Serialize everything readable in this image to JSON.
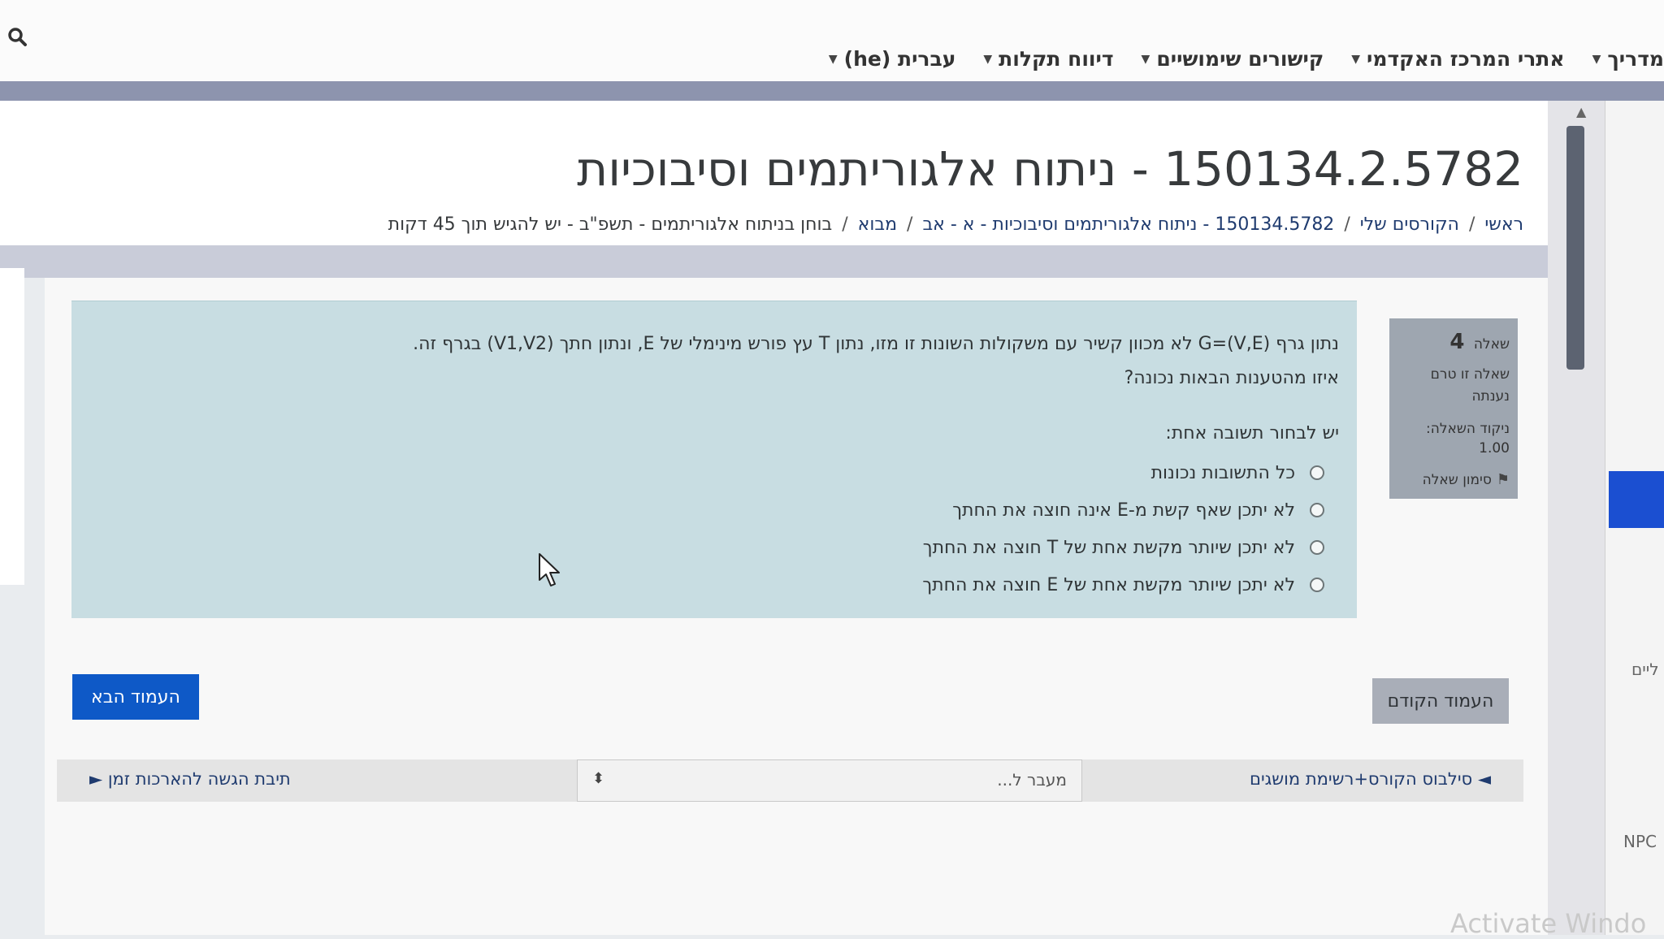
{
  "navbar": {
    "menu": [
      {
        "label": "מדריך"
      },
      {
        "label": "אתרי המרכז האקדמי"
      },
      {
        "label": "קישורים שימושיים"
      },
      {
        "label": "דיווח תקלות"
      },
      {
        "label": "עברית (he)"
      }
    ]
  },
  "header": {
    "title": "150134.2.5782 - ניתוח אלגוריתמים וסיבוכיות",
    "breadcrumb": [
      "ראשי",
      "הקורסים שלי",
      "150134.5782 - ניתוח אלגוריתמים וסיבוכיות - א - אב",
      "מבוא",
      "בוחן בניתוח אלגוריתמים - תשפ\"ב - יש להגיש תוך 45 דקות"
    ]
  },
  "question_info": {
    "number_label": "שאלה",
    "number": "4",
    "status_line1": "שאלה זו טרם",
    "status_line2": "נענתה",
    "points_label": "ניקוד השאלה:",
    "points_value": "1.00",
    "flag_label": "סימון שאלה"
  },
  "question": {
    "text": "נתון גרף G=(V,E) לא מכוון קשיר עם משקולות השונות זו מזו, נתון T עץ פורש מינימלי של E, ונתון חתך (V1,V2) בגרף זה.",
    "prompt": "איזו מהטענות הבאות נכונה?",
    "instruction": "יש לבחור תשובה אחת:",
    "answers": [
      {
        "text": "כל התשובות נכונות"
      },
      {
        "text": "לא יתכן שאף קשת מ-E אינה חוצה את החתך"
      },
      {
        "text": "לא יתכן שיותר מקשת אחת של T חוצה את החתך"
      },
      {
        "text": "לא יתכן שיותר מקשת אחת של E חוצה את החתך"
      }
    ]
  },
  "buttons": {
    "next_page": "העמוד הבא",
    "prev_page": "העמוד הקודם"
  },
  "activity_nav": {
    "prev_link": "◄ סילבוס הקורס+רשימת מושגים",
    "jump_label": "מעבר ל...",
    "next_link": "תיבת הגשה להארכות זמן ►"
  },
  "side_panel": {
    "text1": "ליים",
    "text2": "NPC"
  },
  "watermark": "Activate Windo",
  "colors": {
    "primary": "#0e59c7",
    "question_bg": "#c8dde2",
    "info_bg": "#9ea6b0",
    "navbar_band": "#8d94ae"
  }
}
